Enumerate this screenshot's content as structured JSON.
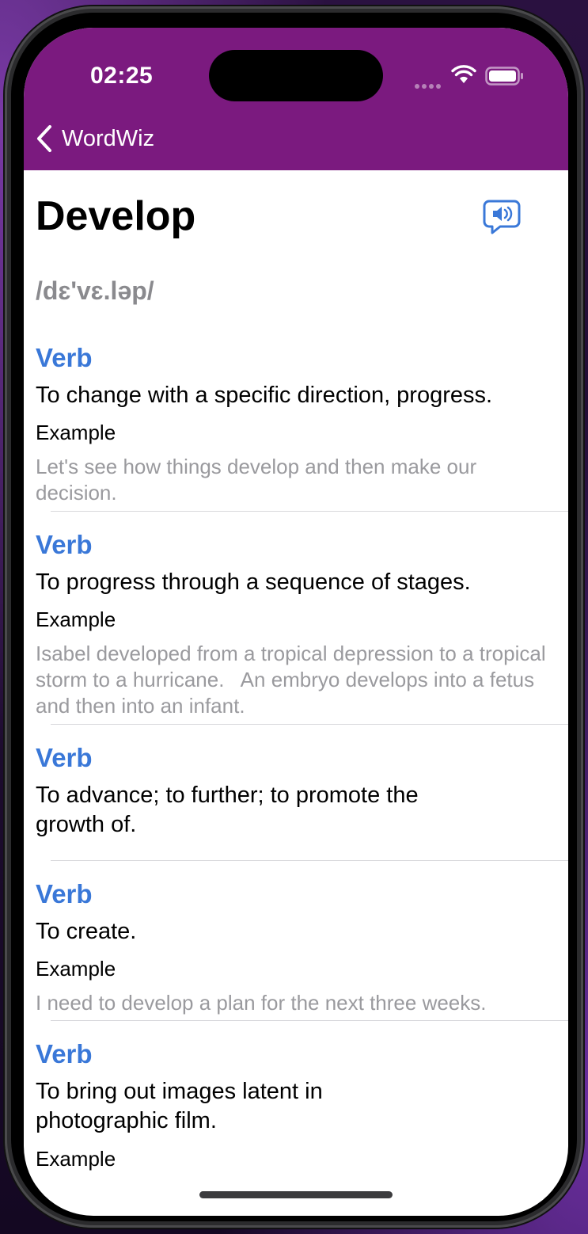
{
  "status_bar": {
    "time": "02:25"
  },
  "nav": {
    "back_label": "WordWiz"
  },
  "word": {
    "title": "Develop",
    "pronunciation": "/dɛ'vɛ.ləp/"
  },
  "entries": [
    {
      "pos": "Verb",
      "definition": "To change with a specific direction, progress.",
      "example_label": "Example",
      "example": "Let's see how things develop and then make our decision."
    },
    {
      "pos": "Verb",
      "definition": "To progress through a sequence of stages.",
      "example_label": "Example",
      "example": "Isabel developed from a tropical depression to a tropical storm to a hurricane.   An embryo develops into a fetus and then into an infant."
    },
    {
      "pos": "Verb",
      "definition": "To advance; to further; to promote the growth of."
    },
    {
      "pos": "Verb",
      "definition": "To create.",
      "example_label": "Example",
      "example": "I need to develop a plan for the next three weeks."
    },
    {
      "pos": "Verb",
      "definition": "To bring out images latent in photographic film.",
      "example_label": "Example"
    }
  ],
  "colors": {
    "nav_bar": "#7b1a7f",
    "accent_blue": "#3a78d8",
    "secondary_text": "#9a9a9e"
  },
  "icons": {
    "back": "chevron-left-icon",
    "speaker": "speaker-bubble-icon",
    "wifi": "wifi-icon",
    "battery": "battery-icon"
  }
}
